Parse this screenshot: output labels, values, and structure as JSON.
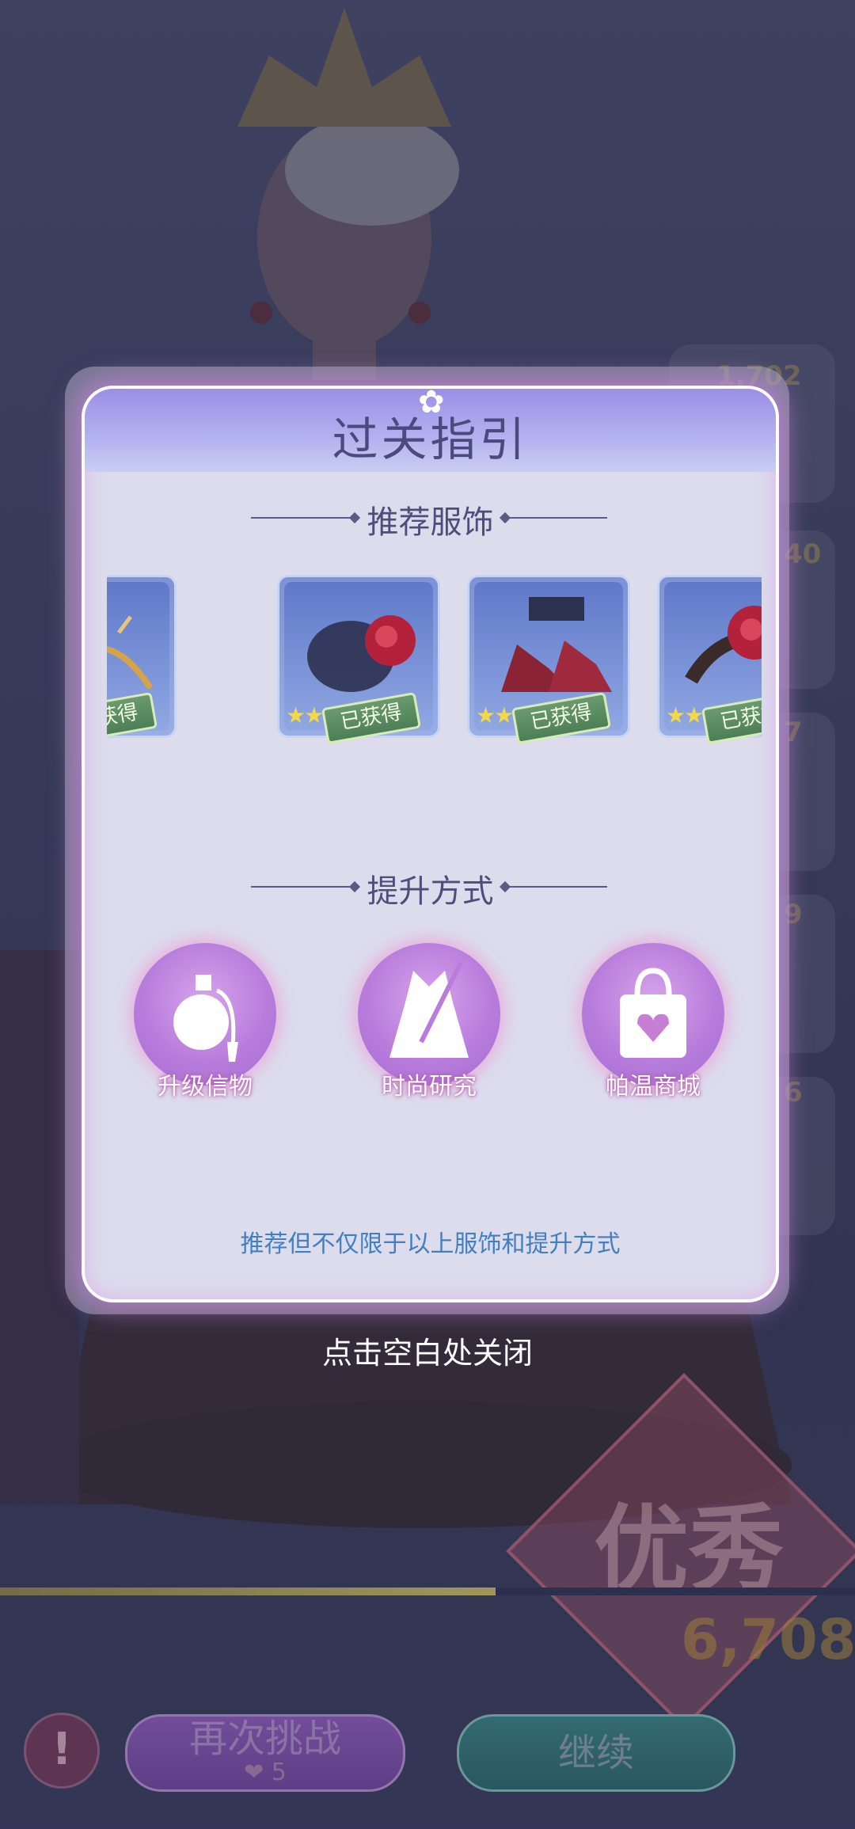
{
  "dialog": {
    "title": "过关指引",
    "recommended_section": "推荐服饰",
    "items": [
      {
        "name": "headpiece",
        "stars_on": 2,
        "stars_total": 5,
        "badge": "已获得"
      },
      {
        "name": "hair-accessory",
        "stars_on": 3,
        "stars_total": 5,
        "badge": "已获得"
      },
      {
        "name": "shoes",
        "stars_on": 3,
        "stars_total": 5,
        "badge": "已获得"
      },
      {
        "name": "flower-clip",
        "stars_on": 3,
        "stars_total": 5,
        "badge": "已获得"
      }
    ],
    "methods_section": "提升方式",
    "methods": [
      {
        "label": "升级信物",
        "icon": "perfume-bottle-icon"
      },
      {
        "label": "时尚研究",
        "icon": "dress-needle-icon"
      },
      {
        "label": "帕温商城",
        "icon": "shopping-bag-icon"
      }
    ],
    "note": "推荐但不仅限于以上服饰和提升方式"
  },
  "close_hint": "点击空白处关闭",
  "background": {
    "side_scores": [
      "1,702",
      "40",
      "7",
      "9",
      "6"
    ],
    "grade": "优秀",
    "score": "6,708",
    "progress": 0.58,
    "retry_label": "再次挑战",
    "retry_cost": "5",
    "continue_label": "继续",
    "hint_symbol": "!"
  },
  "colors": {
    "dialog_bg": "#dcdcec",
    "header_top": "#9d8ee6",
    "note_text": "#3f7fc2",
    "badge_green": "#4d7f57",
    "star_gold": "#f5d74a"
  }
}
